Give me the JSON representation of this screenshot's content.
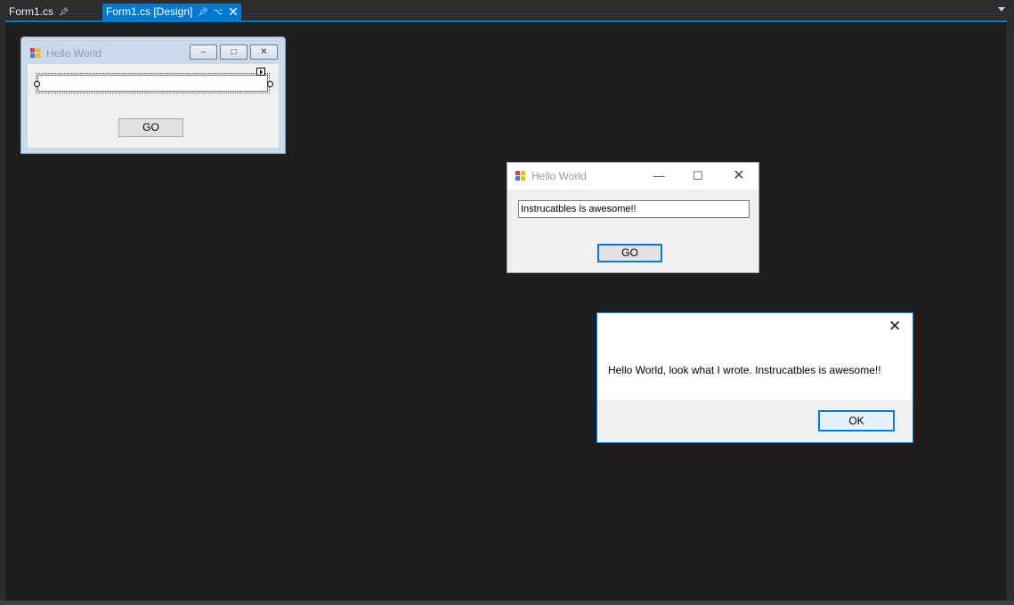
{
  "tabs": [
    {
      "label": "Form1.cs",
      "pin_icon": "pin-icon"
    },
    {
      "label": "Form1.cs [Design]",
      "pin_icon": "pin-icon",
      "keep_icon": "keep-open-icon",
      "close_label": "✕"
    }
  ],
  "colors": {
    "accent": "#007acc",
    "surface": "#1e1e1e",
    "chrome": "#2d2d30",
    "focus_blue": "#0078d7"
  },
  "designer_form": {
    "title": "Hello World",
    "textbox_value": "",
    "button_label": "GO",
    "icon": "app-icon"
  },
  "running_form": {
    "title": "Hello World",
    "textbox_value": "Instrucatbles is awesome!!",
    "button_label": "GO",
    "icon": "app-icon"
  },
  "message_box": {
    "text": "Hello World, look what I wrote. Instrucatbles is awesome!!",
    "ok_label": "OK"
  }
}
